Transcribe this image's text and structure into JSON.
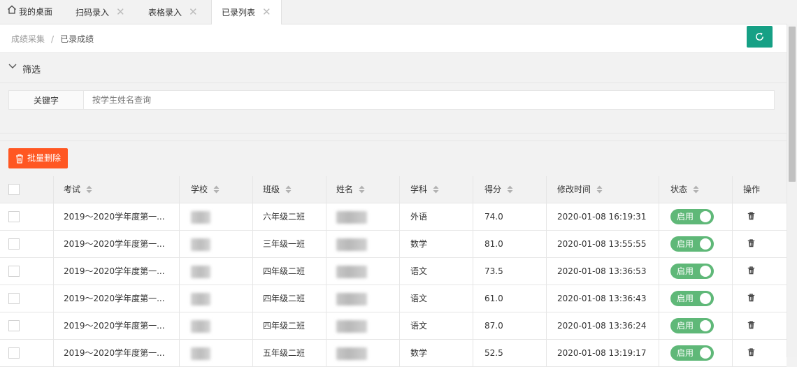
{
  "tabs": [
    {
      "label": "我的桌面",
      "icon": "home-icon",
      "closable": false
    },
    {
      "label": "扫码录入",
      "closable": true
    },
    {
      "label": "表格录入",
      "closable": true
    },
    {
      "label": "已录列表",
      "closable": true,
      "active": true
    }
  ],
  "close_glyph": "✕",
  "breadcrumb": {
    "parent": "成绩采集",
    "separator": "/",
    "current": "已录成绩"
  },
  "refresh_icon": "refresh-icon",
  "filter": {
    "title": "筛选",
    "keyword_label": "关键字",
    "keyword_placeholder": "按学生姓名查询",
    "keyword_value": ""
  },
  "batch_delete_label": "批量删除",
  "table": {
    "columns": [
      "考试",
      "学校",
      "班级",
      "姓名",
      "学科",
      "得分",
      "修改时间",
      "状态",
      "操作"
    ],
    "rows": [
      {
        "exam": "2019～2020学年度第一...",
        "class": "六年级二班",
        "subject": "外语",
        "score": "74.0",
        "time": "2020-01-08 16:19:31",
        "status": "启用"
      },
      {
        "exam": "2019～2020学年度第一...",
        "class": "三年级一班",
        "subject": "数学",
        "score": "81.0",
        "time": "2020-01-08 13:55:55",
        "status": "启用"
      },
      {
        "exam": "2019～2020学年度第一...",
        "class": "四年级二班",
        "subject": "语文",
        "score": "73.5",
        "time": "2020-01-08 13:36:53",
        "status": "启用"
      },
      {
        "exam": "2019～2020学年度第一...",
        "class": "四年级二班",
        "subject": "语文",
        "score": "61.0",
        "time": "2020-01-08 13:36:43",
        "status": "启用"
      },
      {
        "exam": "2019～2020学年度第一...",
        "class": "四年级二班",
        "subject": "语文",
        "score": "87.0",
        "time": "2020-01-08 13:36:24",
        "status": "启用"
      },
      {
        "exam": "2019～2020学年度第一...",
        "class": "五年级二班",
        "subject": "数学",
        "score": "52.5",
        "time": "2020-01-08 13:19:17",
        "status": "启用"
      }
    ]
  },
  "colors": {
    "refresh_button": "#16a085",
    "batch_delete": "#ff5722",
    "switch_on": "#5fb878"
  }
}
